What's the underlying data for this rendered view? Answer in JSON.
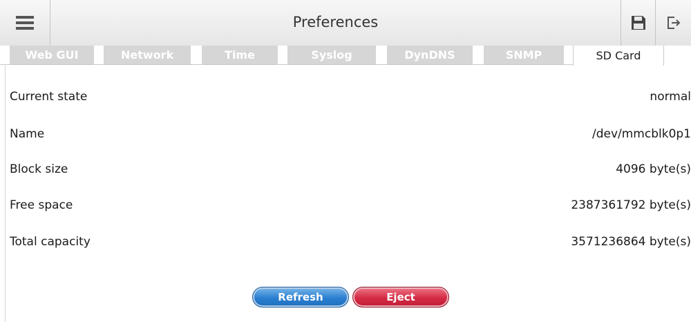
{
  "header": {
    "title": "Preferences",
    "menu_icon": "hamburger-menu-icon",
    "save_icon": "floppy-disk-icon",
    "logout_icon": "logout-icon"
  },
  "tabs": [
    {
      "label": "Web GUI",
      "active": false
    },
    {
      "label": "Network",
      "active": false
    },
    {
      "label": "Time",
      "active": false
    },
    {
      "label": "Syslog",
      "active": false
    },
    {
      "label": "DynDNS",
      "active": false
    },
    {
      "label": "SNMP",
      "active": false
    },
    {
      "label": "SD Card",
      "active": true
    }
  ],
  "sdcard": {
    "rows": [
      {
        "label": "Current state",
        "value": "normal"
      },
      {
        "label": "Name",
        "value": "/dev/mmcblk0p1"
      },
      {
        "label": "Block size",
        "value": "4096 byte(s)"
      },
      {
        "label": "Free space",
        "value": "2387361792 byte(s)"
      },
      {
        "label": "Total capacity",
        "value": "3571236864 byte(s)"
      }
    ]
  },
  "actions": {
    "refresh_label": "Refresh",
    "eject_label": "Eject"
  },
  "colors": {
    "refresh": "#2b7fd0",
    "eject": "#d42a44",
    "inactive_tab": "#d6d6d6"
  }
}
